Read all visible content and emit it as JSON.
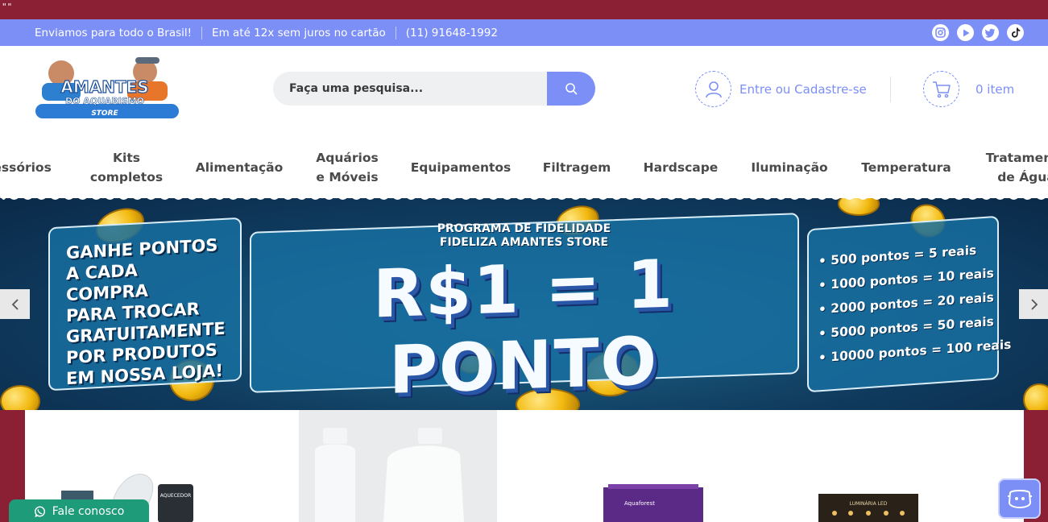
{
  "stray_text": "\"\"",
  "topbar": {
    "messages": [
      "Enviamos para todo o Brasil!",
      "Em até 12x sem juros no cartão",
      "(11) 91648-1992"
    ],
    "social_icons": [
      "instagram-icon",
      "youtube-icon",
      "twitter-icon",
      "tiktok-icon"
    ]
  },
  "logo": {
    "line1": "AMANTES",
    "line2": "DO AQUARISMO",
    "line3": "STORE"
  },
  "search": {
    "placeholder": "Faça uma pesquisa..."
  },
  "account": {
    "label": "Entre ou Cadastre-se"
  },
  "cart": {
    "label": "0 item"
  },
  "nav": {
    "items": [
      "Acessórios",
      "Kits\ncompletos",
      "Alimentação",
      "Aquários\ne Móveis",
      "Equipamentos",
      "Filtragem",
      "Hardscape",
      "Iluminação",
      "Temperatura",
      "Tratamento\nde Água"
    ]
  },
  "banner": {
    "left_lines": [
      "GANHE PONTOS",
      "A CADA COMPRA",
      "PARA TROCAR",
      "GRATUITAMENTE",
      "POR PRODUTOS",
      "EM NOSSA LOJA!"
    ],
    "program_line1": "PROGRAMA DE FIDELIDADE",
    "program_line2": "FIDELIZA AMANTES STORE",
    "headline": "R$1 = 1 PONTO",
    "points": [
      "• 500 pontos = 5 reais",
      "• 1000 pontos = 10 reais",
      "• 2000 pontos = 20 reais",
      "• 5000 pontos = 50 reais",
      "• 10000 pontos = 100 reais"
    ]
  },
  "products": {
    "aquecedor_label": "AQUECEDOR",
    "aquaforest_label": "Aquaforest",
    "luminaria_label": "LUMINÁRIA LED"
  },
  "chat": {
    "label": "Fale conosco"
  },
  "colors": {
    "accent": "#7b8ff6",
    "page_bg": "#8b1f33",
    "whatsapp": "#1e9b78"
  }
}
